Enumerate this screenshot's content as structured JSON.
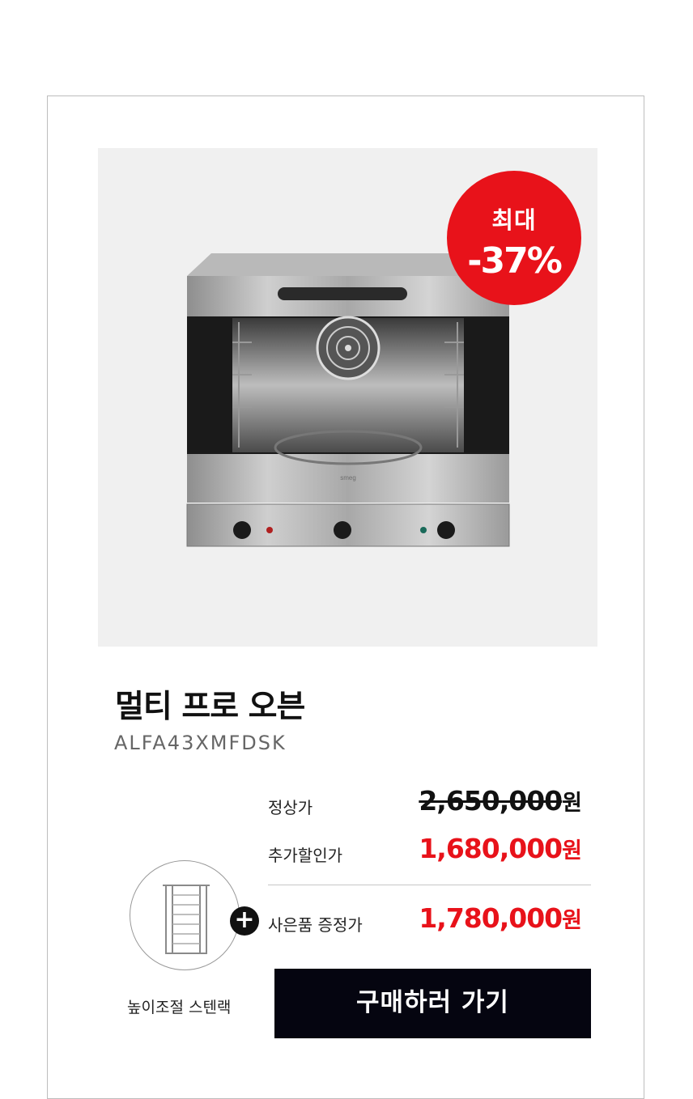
{
  "badge": {
    "line1": "최대",
    "line2": "-37%"
  },
  "product": {
    "title": "멀티 프로 오븐",
    "model": "ALFA43XMFDSK",
    "brand_mark": "smeg"
  },
  "prices": {
    "regular_label": "정상가",
    "regular_value": "2,650,000",
    "sale_label": "추가할인가",
    "sale_value": "1,680,000",
    "gift_label": "사은품 증정가",
    "gift_value": "1,780,000",
    "currency": "원"
  },
  "gift": {
    "caption": "높이조절 스텐랙",
    "plus_symbol": "+"
  },
  "cta": {
    "label": "구매하러 가기"
  },
  "colors": {
    "accent": "#e8121a",
    "button": "#050510",
    "panel": "#f0f0f0"
  }
}
